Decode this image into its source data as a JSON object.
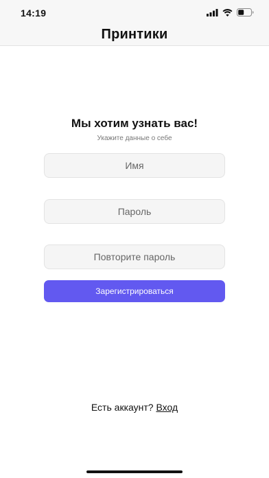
{
  "status_bar": {
    "time": "14:19",
    "icons": [
      "cellular-signal-icon",
      "wifi-icon",
      "battery-icon"
    ]
  },
  "header": {
    "title": "Принтики"
  },
  "form": {
    "heading": "Мы хотим узнать вас!",
    "subheading": "Укажите данные о себе",
    "name_placeholder": "Имя",
    "password_placeholder": "Пароль",
    "password_repeat_placeholder": "Повторите пароль",
    "submit_label": "Зарегистрироваться"
  },
  "footer": {
    "prompt": "Есть аккаунт?",
    "login_label": "Вход"
  },
  "colors": {
    "accent": "#6259f0",
    "field_background": "#f5f5f5",
    "bar_background": "#f7f7f7"
  }
}
